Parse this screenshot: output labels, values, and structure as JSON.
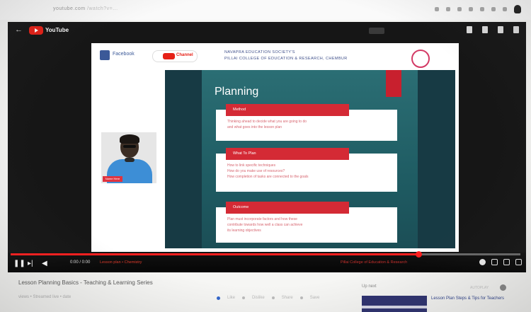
{
  "browser": {
    "url": "youtube.com",
    "url_tail": "/watch?v=..."
  },
  "player": {
    "logo_text": "YouTube",
    "slide": {
      "facebook_text": "Facebook",
      "youtube_text": "Channel",
      "header_line1": "NAVAPRA EDUCATION SOCIETY'S",
      "header_line2": "PILLAI COLLEGE OF EDUCATION & RESEARCH, CHEMBUR",
      "webcam_label": "Name Here",
      "title": "Planning",
      "boxes": [
        {
          "label": "Method",
          "lines": [
            "Thinking ahead to decide what you are going to do",
            "and what goes into the lesson plan"
          ]
        },
        {
          "label": "What To Plan",
          "lines": [
            "How to link specific techniques",
            "How do you make use of resources?",
            "How completion of tasks are connected to the goals"
          ]
        },
        {
          "label": "Outcome",
          "lines": [
            "Plan must incorporate factors and how these",
            "contribute towards how well a class can achieve",
            "its learning objectives"
          ]
        }
      ]
    },
    "controls": {
      "time": "0:00 / 0:00",
      "chapter": "Lesson plan • Chemistry",
      "overlay": "Pillai College of Education & Research",
      "progress_fraction": 0.8
    }
  },
  "video": {
    "title": "Lesson Planning Basics - Teaching & Learning Series",
    "meta": "views • Streamed live • date",
    "actions": [
      "Like",
      "Dislike",
      "Share",
      "Save"
    ]
  },
  "sidebar": {
    "up_next": "Up next",
    "autoplay": "AUTOPLAY",
    "rec_title": "Lesson Plan Steps & Tips for Teachers"
  }
}
